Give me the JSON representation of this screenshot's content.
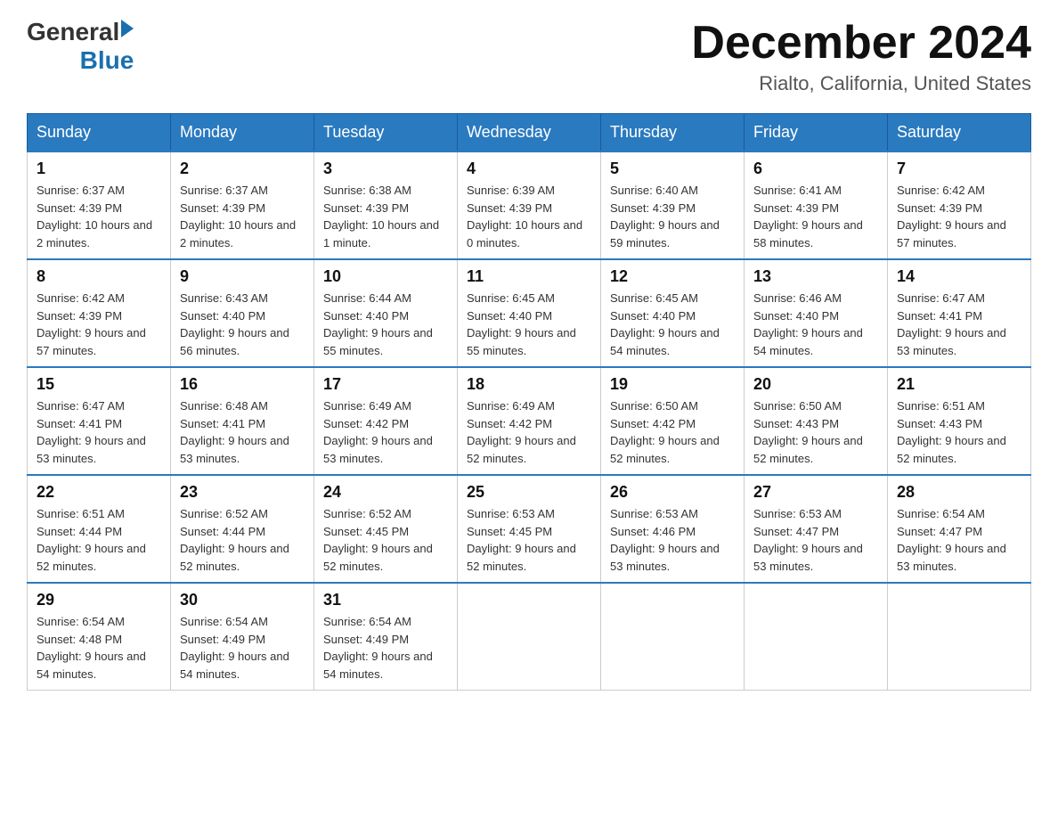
{
  "header": {
    "logo_general": "General",
    "logo_blue": "Blue",
    "title": "December 2024",
    "location": "Rialto, California, United States"
  },
  "days_of_week": [
    "Sunday",
    "Monday",
    "Tuesday",
    "Wednesday",
    "Thursday",
    "Friday",
    "Saturday"
  ],
  "weeks": [
    [
      {
        "day": "1",
        "sunrise": "6:37 AM",
        "sunset": "4:39 PM",
        "daylight": "10 hours and 2 minutes."
      },
      {
        "day": "2",
        "sunrise": "6:37 AM",
        "sunset": "4:39 PM",
        "daylight": "10 hours and 2 minutes."
      },
      {
        "day": "3",
        "sunrise": "6:38 AM",
        "sunset": "4:39 PM",
        "daylight": "10 hours and 1 minute."
      },
      {
        "day": "4",
        "sunrise": "6:39 AM",
        "sunset": "4:39 PM",
        "daylight": "10 hours and 0 minutes."
      },
      {
        "day": "5",
        "sunrise": "6:40 AM",
        "sunset": "4:39 PM",
        "daylight": "9 hours and 59 minutes."
      },
      {
        "day": "6",
        "sunrise": "6:41 AM",
        "sunset": "4:39 PM",
        "daylight": "9 hours and 58 minutes."
      },
      {
        "day": "7",
        "sunrise": "6:42 AM",
        "sunset": "4:39 PM",
        "daylight": "9 hours and 57 minutes."
      }
    ],
    [
      {
        "day": "8",
        "sunrise": "6:42 AM",
        "sunset": "4:39 PM",
        "daylight": "9 hours and 57 minutes."
      },
      {
        "day": "9",
        "sunrise": "6:43 AM",
        "sunset": "4:40 PM",
        "daylight": "9 hours and 56 minutes."
      },
      {
        "day": "10",
        "sunrise": "6:44 AM",
        "sunset": "4:40 PM",
        "daylight": "9 hours and 55 minutes."
      },
      {
        "day": "11",
        "sunrise": "6:45 AM",
        "sunset": "4:40 PM",
        "daylight": "9 hours and 55 minutes."
      },
      {
        "day": "12",
        "sunrise": "6:45 AM",
        "sunset": "4:40 PM",
        "daylight": "9 hours and 54 minutes."
      },
      {
        "day": "13",
        "sunrise": "6:46 AM",
        "sunset": "4:40 PM",
        "daylight": "9 hours and 54 minutes."
      },
      {
        "day": "14",
        "sunrise": "6:47 AM",
        "sunset": "4:41 PM",
        "daylight": "9 hours and 53 minutes."
      }
    ],
    [
      {
        "day": "15",
        "sunrise": "6:47 AM",
        "sunset": "4:41 PM",
        "daylight": "9 hours and 53 minutes."
      },
      {
        "day": "16",
        "sunrise": "6:48 AM",
        "sunset": "4:41 PM",
        "daylight": "9 hours and 53 minutes."
      },
      {
        "day": "17",
        "sunrise": "6:49 AM",
        "sunset": "4:42 PM",
        "daylight": "9 hours and 53 minutes."
      },
      {
        "day": "18",
        "sunrise": "6:49 AM",
        "sunset": "4:42 PM",
        "daylight": "9 hours and 52 minutes."
      },
      {
        "day": "19",
        "sunrise": "6:50 AM",
        "sunset": "4:42 PM",
        "daylight": "9 hours and 52 minutes."
      },
      {
        "day": "20",
        "sunrise": "6:50 AM",
        "sunset": "4:43 PM",
        "daylight": "9 hours and 52 minutes."
      },
      {
        "day": "21",
        "sunrise": "6:51 AM",
        "sunset": "4:43 PM",
        "daylight": "9 hours and 52 minutes."
      }
    ],
    [
      {
        "day": "22",
        "sunrise": "6:51 AM",
        "sunset": "4:44 PM",
        "daylight": "9 hours and 52 minutes."
      },
      {
        "day": "23",
        "sunrise": "6:52 AM",
        "sunset": "4:44 PM",
        "daylight": "9 hours and 52 minutes."
      },
      {
        "day": "24",
        "sunrise": "6:52 AM",
        "sunset": "4:45 PM",
        "daylight": "9 hours and 52 minutes."
      },
      {
        "day": "25",
        "sunrise": "6:53 AM",
        "sunset": "4:45 PM",
        "daylight": "9 hours and 52 minutes."
      },
      {
        "day": "26",
        "sunrise": "6:53 AM",
        "sunset": "4:46 PM",
        "daylight": "9 hours and 53 minutes."
      },
      {
        "day": "27",
        "sunrise": "6:53 AM",
        "sunset": "4:47 PM",
        "daylight": "9 hours and 53 minutes."
      },
      {
        "day": "28",
        "sunrise": "6:54 AM",
        "sunset": "4:47 PM",
        "daylight": "9 hours and 53 minutes."
      }
    ],
    [
      {
        "day": "29",
        "sunrise": "6:54 AM",
        "sunset": "4:48 PM",
        "daylight": "9 hours and 54 minutes."
      },
      {
        "day": "30",
        "sunrise": "6:54 AM",
        "sunset": "4:49 PM",
        "daylight": "9 hours and 54 minutes."
      },
      {
        "day": "31",
        "sunrise": "6:54 AM",
        "sunset": "4:49 PM",
        "daylight": "9 hours and 54 minutes."
      },
      null,
      null,
      null,
      null
    ]
  ]
}
